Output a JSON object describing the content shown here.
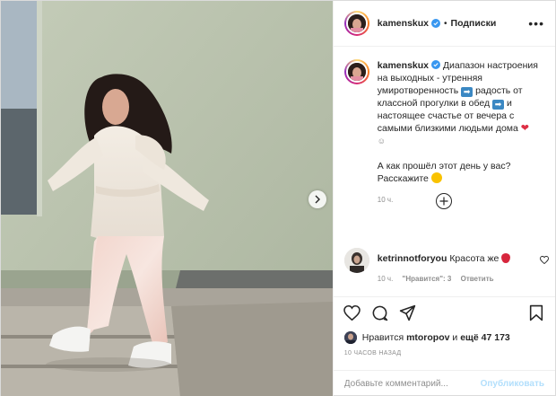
{
  "header": {
    "username": "kamenskux",
    "separator": "•",
    "follow_label": "Подписки",
    "more_label": "•••"
  },
  "caption": {
    "username": "kamenskux",
    "text_1": "Диапазон настроения на выходных - утренняя умиротворенность",
    "text_2": "радость от классной прогулки в обед",
    "text_3": "и настоящее счастье от вечера с самыми близкими людьми дома",
    "text_4": "А как прошёл этот день у вас? Расскажите",
    "time": "10 ч."
  },
  "comment": {
    "username": "ketrinnotforyou",
    "text": "Красота же",
    "time": "10 ч.",
    "likes_label": "\"Нравится\": 3",
    "reply_label": "Ответить"
  },
  "likes": {
    "prefix": "Нравится",
    "user": "mtoropov",
    "middle": "и",
    "others": "ещё 47 173"
  },
  "post_time": "10 ЧАСОВ НАЗАД",
  "add_comment": {
    "placeholder": "Добавьте комментарий...",
    "publish_label": "Опубликовать"
  },
  "colors": {
    "link_disabled": "#b2dffc",
    "verified": "#3897f0",
    "heart": "#dd2e44"
  }
}
